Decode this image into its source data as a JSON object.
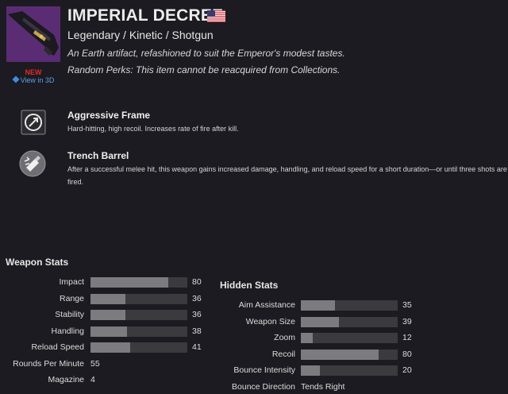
{
  "header": {
    "title": "IMPERIAL DECREE",
    "subtitle": "Legendary / Kinetic / Shotgun",
    "flavor": "An Earth artifact, refashioned to suit the Emperor's modest tastes.",
    "random_perks": "Random Perks: This item cannot be reacquired from Collections.",
    "new_badge": "NEW",
    "view_3d": "View in 3D",
    "flag_icon": "us-flag-icon"
  },
  "perks": [
    {
      "name": "Aggressive Frame",
      "description": "Hard-hitting, high recoil. Increases rate of fire after kill.",
      "icon": "aggressive-frame-icon"
    },
    {
      "name": "Trench Barrel",
      "description": "After a successful melee hit, this weapon gains increased damage, handling, and reload speed for a short duration—or until three shots are fired.",
      "icon": "trench-barrel-icon"
    }
  ],
  "weapon_stats": {
    "title": "Weapon Stats",
    "bars": [
      {
        "label": "Impact",
        "value": 80
      },
      {
        "label": "Range",
        "value": 36
      },
      {
        "label": "Stability",
        "value": 36
      },
      {
        "label": "Handling",
        "value": 38
      },
      {
        "label": "Reload Speed",
        "value": 41
      }
    ],
    "text_stats": [
      {
        "label": "Rounds Per Minute",
        "value": "55"
      },
      {
        "label": "Magazine",
        "value": "4"
      }
    ]
  },
  "hidden_stats": {
    "title": "Hidden Stats",
    "bars": [
      {
        "label": "Aim Assistance",
        "value": 35
      },
      {
        "label": "Weapon Size",
        "value": 39
      },
      {
        "label": "Zoom",
        "value": 12
      },
      {
        "label": "Recoil",
        "value": 80
      },
      {
        "label": "Bounce Intensity",
        "value": 20
      }
    ],
    "text_stats": [
      {
        "label": "Bounce Direction",
        "value": "Tends Right"
      }
    ]
  }
}
